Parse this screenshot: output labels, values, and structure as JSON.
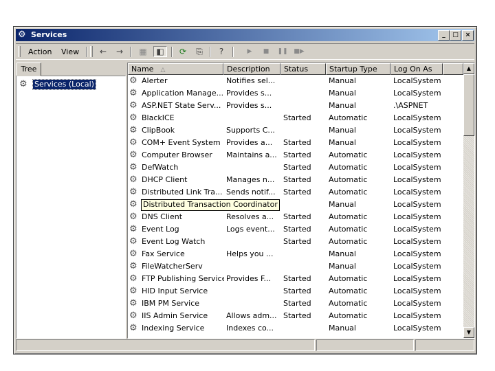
{
  "window": {
    "title": "Services",
    "app_icon": "services-gear-icon",
    "title_buttons": {
      "minimize": "_",
      "maximize": "□",
      "close": "×"
    }
  },
  "menu": {
    "action": "Action",
    "view": "View"
  },
  "toolbar": {
    "icons": [
      "back-arrow-icon",
      "forward-arrow-icon",
      "up-folder-icon",
      "show-hide-tree-icon",
      "refresh-icon",
      "export-list-icon",
      "help-icon",
      "start-service-icon",
      "stop-service-icon",
      "pause-service-icon",
      "restart-service-icon"
    ]
  },
  "tree": {
    "tab": "Tree",
    "root": "Services (Local)"
  },
  "list": {
    "headers": {
      "name": "Name",
      "description": "Description",
      "status": "Status",
      "startup": "Startup Type",
      "logon": "Log On As"
    },
    "sort_arrow": "△",
    "tooltip": "Distributed Transaction Coordinator",
    "rows": [
      {
        "name": "Alerter",
        "description": "Notifies sel...",
        "status": "",
        "startup": "Manual",
        "logon": "LocalSystem"
      },
      {
        "name": "Application Manage...",
        "description": "Provides s...",
        "status": "",
        "startup": "Manual",
        "logon": "LocalSystem"
      },
      {
        "name": "ASP.NET State Serv...",
        "description": "Provides s...",
        "status": "",
        "startup": "Manual",
        "logon": ".\\ASPNET"
      },
      {
        "name": "BlackICE",
        "description": "",
        "status": "Started",
        "startup": "Automatic",
        "logon": "LocalSystem"
      },
      {
        "name": "ClipBook",
        "description": "Supports C...",
        "status": "",
        "startup": "Manual",
        "logon": "LocalSystem"
      },
      {
        "name": "COM+ Event System",
        "description": "Provides a...",
        "status": "Started",
        "startup": "Manual",
        "logon": "LocalSystem"
      },
      {
        "name": "Computer Browser",
        "description": "Maintains a...",
        "status": "Started",
        "startup": "Automatic",
        "logon": "LocalSystem"
      },
      {
        "name": "DefWatch",
        "description": "",
        "status": "Started",
        "startup": "Automatic",
        "logon": "LocalSystem"
      },
      {
        "name": "DHCP Client",
        "description": "Manages n...",
        "status": "Started",
        "startup": "Automatic",
        "logon": "LocalSystem"
      },
      {
        "name": "Distributed Link Tra...",
        "description": "Sends notif...",
        "status": "Started",
        "startup": "Automatic",
        "logon": "LocalSystem"
      },
      {
        "name": "Distributed Transaction Coordinator",
        "description": "",
        "status": "",
        "startup": "Manual",
        "logon": "LocalSystem"
      },
      {
        "name": "DNS Client",
        "description": "Resolves a...",
        "status": "Started",
        "startup": "Automatic",
        "logon": "LocalSystem"
      },
      {
        "name": "Event Log",
        "description": "Logs event...",
        "status": "Started",
        "startup": "Automatic",
        "logon": "LocalSystem"
      },
      {
        "name": "Event Log Watch",
        "description": "",
        "status": "Started",
        "startup": "Automatic",
        "logon": "LocalSystem"
      },
      {
        "name": "Fax Service",
        "description": "Helps you ...",
        "status": "",
        "startup": "Manual",
        "logon": "LocalSystem"
      },
      {
        "name": "FileWatcherServ",
        "description": "",
        "status": "",
        "startup": "Manual",
        "logon": "LocalSystem"
      },
      {
        "name": "FTP Publishing Service",
        "description": "Provides F...",
        "status": "Started",
        "startup": "Automatic",
        "logon": "LocalSystem"
      },
      {
        "name": "HID Input Service",
        "description": "",
        "status": "Started",
        "startup": "Automatic",
        "logon": "LocalSystem"
      },
      {
        "name": "IBM PM Service",
        "description": "",
        "status": "Started",
        "startup": "Automatic",
        "logon": "LocalSystem"
      },
      {
        "name": "IIS Admin Service",
        "description": "Allows adm...",
        "status": "Started",
        "startup": "Automatic",
        "logon": "LocalSystem"
      },
      {
        "name": "Indexing Service",
        "description": "Indexes co...",
        "status": "",
        "startup": "Manual",
        "logon": "LocalSystem"
      }
    ]
  },
  "colors": {
    "title_start": "#0a246a",
    "title_end": "#a6caf0",
    "chrome": "#d4d0c8",
    "selection": "#0a246a",
    "tooltip_bg": "#ffffe1"
  }
}
